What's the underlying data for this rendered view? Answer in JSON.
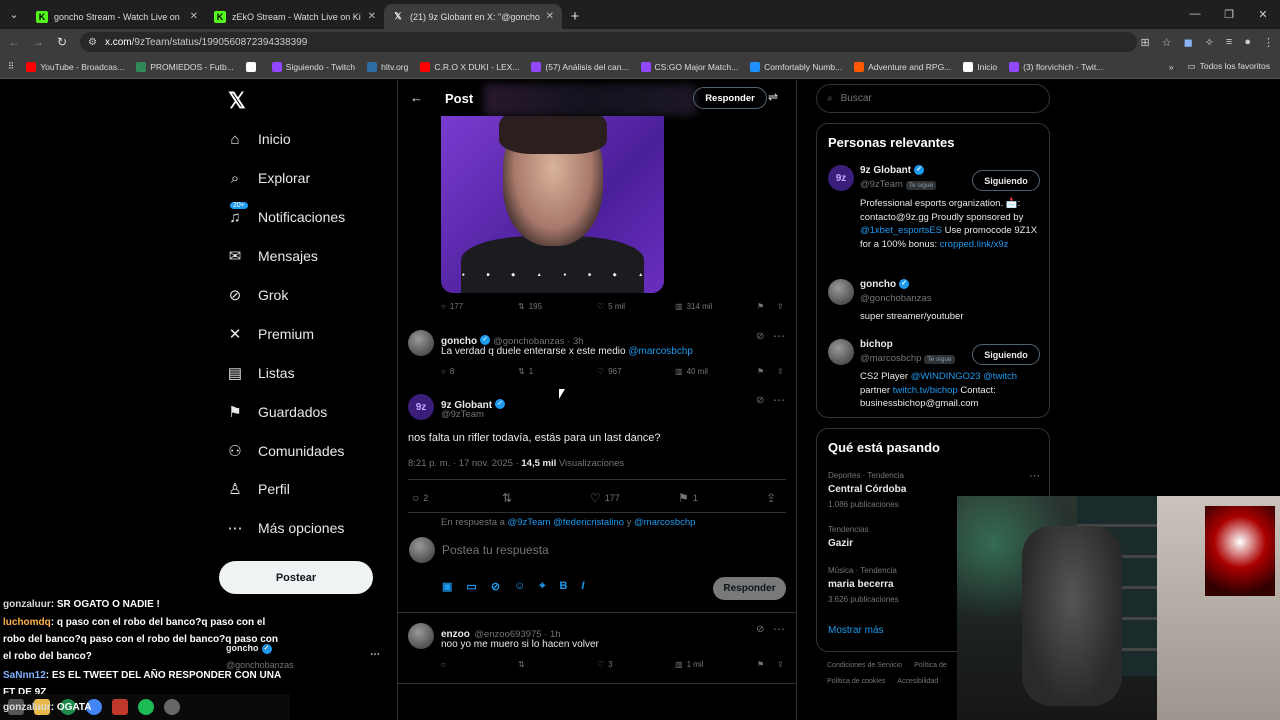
{
  "browser": {
    "tabs": [
      {
        "label": "goncho Stream - Watch Live on",
        "icon": "kick-icon",
        "color": "#53fc18",
        "active": false
      },
      {
        "label": "zEkO Stream - Watch Live on Ki",
        "icon": "kick-icon",
        "color": "#53fc18",
        "active": false
      },
      {
        "label": "(21) 9z Globant en X: \"@goncho",
        "icon": "x-icon",
        "color": "#ffffff",
        "active": true
      }
    ],
    "url_host": "x.com",
    "url_path": "/9zTeam/status/1990560872394338399",
    "bookmarks": [
      {
        "label": "YouTube - Broadcas...",
        "color": "#ff0000"
      },
      {
        "label": "PROMIEDOS - Futb...",
        "color": "#2e8b57"
      },
      {
        "label": "",
        "color": "#ffffff"
      },
      {
        "label": "Siguiendo - Twitch",
        "color": "#9146ff"
      },
      {
        "label": "hltv.org",
        "color": "#2d6da3"
      },
      {
        "label": "C.R.O X DUKI - LEX...",
        "color": "#ff0000"
      },
      {
        "label": "(57) Análisis del can...",
        "color": "#9146ff"
      },
      {
        "label": "CS:GO Major Match...",
        "color": "#9146ff"
      },
      {
        "label": "Comfortably Numb...",
        "color": "#1e90ff"
      },
      {
        "label": "Adventure and RPG...",
        "color": "#ff5a00"
      },
      {
        "label": "Inicio",
        "color": "#ffffff"
      },
      {
        "label": "(3) florvichich - Twit...",
        "color": "#9146ff"
      }
    ],
    "bookmarks_folder": "Todos los favoritos"
  },
  "nav": {
    "items": [
      {
        "label": "Inicio",
        "icon": "home-icon",
        "glyph": "⌂"
      },
      {
        "label": "Explorar",
        "icon": "search-icon",
        "glyph": "⌕"
      },
      {
        "label": "Notificaciones",
        "icon": "bell-icon",
        "glyph": "♫"
      },
      {
        "label": "Mensajes",
        "icon": "mail-icon",
        "glyph": "✉"
      },
      {
        "label": "Grok",
        "icon": "grok-icon",
        "glyph": "⊘"
      },
      {
        "label": "Premium",
        "icon": "x-premium-icon",
        "glyph": "✕"
      },
      {
        "label": "Listas",
        "icon": "list-icon",
        "glyph": "▤"
      },
      {
        "label": "Guardados",
        "icon": "bookmark-icon",
        "glyph": "⚑"
      },
      {
        "label": "Comunidades",
        "icon": "communities-icon",
        "glyph": "⚇"
      },
      {
        "label": "Perfil",
        "icon": "profile-icon",
        "glyph": "♙"
      },
      {
        "label": "Más opciones",
        "icon": "more-icon",
        "glyph": "⋯"
      }
    ],
    "notif_badge": "20+",
    "post_button": "Postear"
  },
  "center": {
    "header_title": "Post",
    "reply_button": "Responder",
    "media_actions": {
      "replies": "177",
      "reposts": "195",
      "likes": "5 mil",
      "views": "314 mil"
    },
    "reply1": {
      "name": "goncho",
      "handle": "@gonchobanzas · 3h",
      "text": "La verdad q duele enterarse x este medio",
      "mention": "@marcosbchp",
      "actions": {
        "replies": "8",
        "reposts": "1",
        "likes": "967",
        "views": "40 mil"
      }
    },
    "main": {
      "name": "9z Globant",
      "handle": "@9zTeam",
      "text": "nos falta un rifler todavía, estás para un last dance?",
      "time": "8:21 p. m. · 17 nov. 2025 ·",
      "views_count": "14,5 mil",
      "views_label": "Visualizaciones",
      "actions": {
        "replies": "2",
        "reposts": "",
        "likes": "177",
        "bookmarks": "1"
      }
    },
    "reply_to": {
      "prefix": "En respuesta a",
      "mentions": "@9zTeam @federicristalino",
      "and": "y",
      "last": "@marcosbchp"
    },
    "reply_placeholder": "Postea tu respuesta",
    "reply_submit": "Responder",
    "reply2": {
      "name": "enzoo",
      "handle": "@enzoo693975 · 1h",
      "text": "noo yo me muero si lo hacen volver",
      "actions": {
        "replies": "",
        "reposts": "",
        "likes": "3",
        "views": "1 mil"
      }
    }
  },
  "right": {
    "search_placeholder": "Buscar",
    "relevant_title": "Personas relevantes",
    "people": [
      {
        "name": "9z Globant",
        "handle": "@9zTeam",
        "tag": "Te sigue",
        "button": "Siguiendo",
        "bio": "Professional esports organization. 📩: contacto@9z.gg Proudly sponsored by",
        "bio_link": "@1xbet_esportsES",
        "bio2": "Use promocode 9Z1X for a 100% bonus:",
        "bio_link2": "cropped.link/x9z"
      },
      {
        "name": "goncho",
        "handle": "@gonchobanzas",
        "tag": "",
        "button": "",
        "bio": "super streamer/youtuber"
      },
      {
        "name": "bichop",
        "handle": "@marcosbchp",
        "tag": "Te sigue",
        "button": "Siguiendo",
        "bio": "CS2 Player",
        "bio_link": "@WINDINGO23 @twitch",
        "bio2": "partner",
        "bio_link2": "twitch.tv/bichop",
        "bio3": "Contact: businessbichop@gmail.com"
      }
    ],
    "trending_title": "Qué está pasando",
    "trends": [
      {
        "category": "Deportes · Tendencia",
        "name": "Central Córdoba",
        "posts": "1.086 publicaciones"
      },
      {
        "category": "Tendencias",
        "name": "Gazir",
        "posts": ""
      },
      {
        "category": "Música · Tendencia",
        "name": "maria becerra",
        "posts": "3.626 publicaciones"
      }
    ],
    "show_more": "Mostrar más",
    "footer": [
      "Condiciones de Servicio",
      "Política de",
      "Política de cookies",
      "Accesibilidad"
    ]
  },
  "chat": [
    {
      "user": "gonzaluur",
      "color": "#d8d8d8",
      "text": ": SR OGATO O NADIE !"
    },
    {
      "user": "luchomdq",
      "color": "#ffb347",
      "text": ": q paso con el robo del banco?q paso con el"
    },
    {
      "user": "",
      "color": "#fff",
      "text": "robo del banco?q paso con el robo del banco?q paso con"
    },
    {
      "user": "",
      "color": "#fff",
      "text": "el robo del banco?"
    },
    {
      "user": "SaNnn12",
      "color": "#7fb2ff",
      "text": ": ES EL TWEET DEL AÑO RESPONDER CON UNA"
    },
    {
      "user": "",
      "color": "#fff",
      "text": "FT DE 9Z"
    },
    {
      "user": "gonzaluur",
      "color": "#d8d8d8",
      "text": ": OGATA"
    }
  ],
  "overlay_profile": {
    "name": "goncho",
    "handle": "@gonchobanzas"
  }
}
